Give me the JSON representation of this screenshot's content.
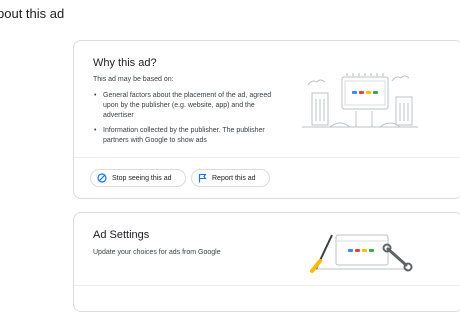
{
  "page": {
    "heading": "bout this ad"
  },
  "why_card": {
    "title": "Why this ad?",
    "intro": "This ad may be based on:",
    "reasons": [
      "General factors about the placement of the ad, agreed upon by the publisher (e.g. website, app) and the advertiser",
      "Information collected by the publisher. The publisher partners with Google to show ads"
    ],
    "actions": {
      "stop_label": "Stop seeing this ad",
      "stop_icon": "block-icon",
      "report_label": "Report this ad",
      "report_icon": "flag-icon"
    },
    "illustration": "billboard-illustration"
  },
  "settings_card": {
    "title": "Ad Settings",
    "description": "Update your choices for ads from Google",
    "illustration": "tools-illustration"
  },
  "colors": {
    "blue": "#4285f4",
    "red": "#ea4335",
    "yellow": "#fbbc04",
    "green": "#34a853",
    "border": "#dadce0",
    "text": "#202124"
  }
}
